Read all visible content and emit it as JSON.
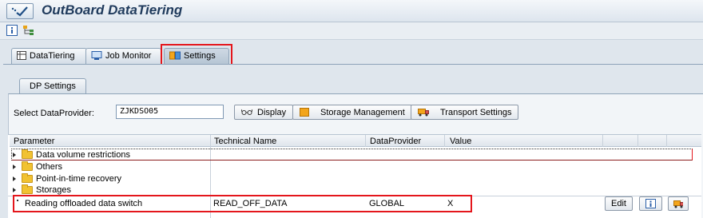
{
  "window": {
    "title": "OutBoard DataTiering"
  },
  "tabs": [
    {
      "label": "DataTiering",
      "icon": "table-icon"
    },
    {
      "label": "Job Monitor",
      "icon": "monitor-icon"
    },
    {
      "label": "Settings",
      "icon": "settings-icon",
      "active": true
    }
  ],
  "subtab": {
    "label": "DP Settings"
  },
  "select": {
    "label": "Select DataProvider:",
    "value": "ZJKDSO05"
  },
  "buttons": {
    "display": "Display",
    "storage": "Storage Management",
    "transport": "Transport Settings"
  },
  "table": {
    "columns": [
      "Parameter",
      "Technical Name",
      "DataProvider",
      "Value"
    ],
    "tree": [
      "Data volume restrictions",
      "Others",
      "Point-in-time recovery",
      "Storages"
    ],
    "selected_row": {
      "parameter": "Reading offloaded data switch",
      "technical_name": "READ_OFF_DATA",
      "dataprovider": "GLOBAL",
      "value": "X"
    },
    "edit_button": "Edit"
  },
  "colors": {
    "highlight": "#e4161c",
    "title": "#1f3a5c",
    "folder": "#f1c232"
  }
}
